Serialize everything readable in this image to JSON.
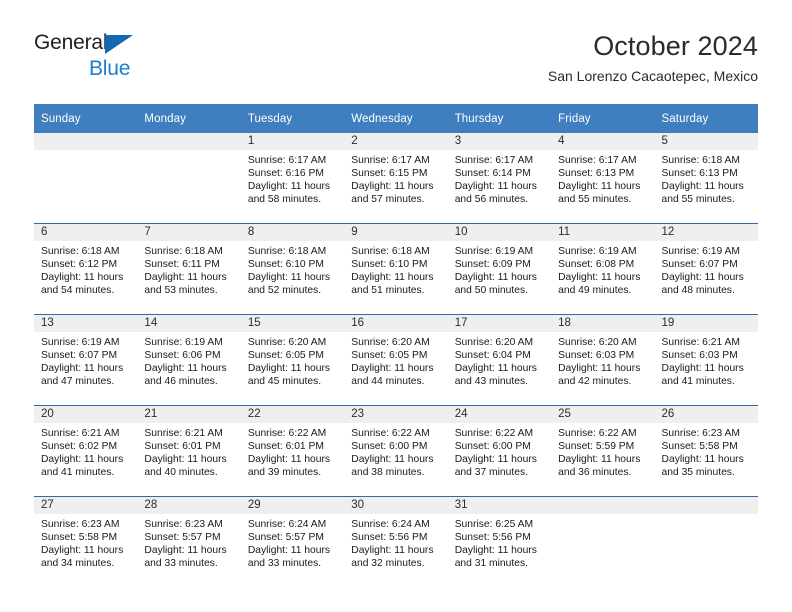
{
  "brand": {
    "name_top": "General",
    "name_bottom": "Blue"
  },
  "header": {
    "title": "October 2024",
    "subtitle": "San Lorenzo Cacaotepec, Mexico"
  },
  "calendar": {
    "weekday_headers": [
      "Sunday",
      "Monday",
      "Tuesday",
      "Wednesday",
      "Thursday",
      "Friday",
      "Saturday"
    ],
    "colors": {
      "header_background": "#3f7fbf",
      "header_text": "#ffffff",
      "daynum_band": "#efefef",
      "week_separator": "#2f6ca8",
      "brand_blue": "#1b7ed1",
      "cell_background": "#ffffff"
    },
    "weeks": [
      [
        {
          "day": "",
          "sunrise": "",
          "sunset": "",
          "daylight": ""
        },
        {
          "day": "",
          "sunrise": "",
          "sunset": "",
          "daylight": ""
        },
        {
          "day": "1",
          "sunrise": "Sunrise: 6:17 AM",
          "sunset": "Sunset: 6:16 PM",
          "daylight": "Daylight: 11 hours and 58 minutes."
        },
        {
          "day": "2",
          "sunrise": "Sunrise: 6:17 AM",
          "sunset": "Sunset: 6:15 PM",
          "daylight": "Daylight: 11 hours and 57 minutes."
        },
        {
          "day": "3",
          "sunrise": "Sunrise: 6:17 AM",
          "sunset": "Sunset: 6:14 PM",
          "daylight": "Daylight: 11 hours and 56 minutes."
        },
        {
          "day": "4",
          "sunrise": "Sunrise: 6:17 AM",
          "sunset": "Sunset: 6:13 PM",
          "daylight": "Daylight: 11 hours and 55 minutes."
        },
        {
          "day": "5",
          "sunrise": "Sunrise: 6:18 AM",
          "sunset": "Sunset: 6:13 PM",
          "daylight": "Daylight: 11 hours and 55 minutes."
        }
      ],
      [
        {
          "day": "6",
          "sunrise": "Sunrise: 6:18 AM",
          "sunset": "Sunset: 6:12 PM",
          "daylight": "Daylight: 11 hours and 54 minutes."
        },
        {
          "day": "7",
          "sunrise": "Sunrise: 6:18 AM",
          "sunset": "Sunset: 6:11 PM",
          "daylight": "Daylight: 11 hours and 53 minutes."
        },
        {
          "day": "8",
          "sunrise": "Sunrise: 6:18 AM",
          "sunset": "Sunset: 6:10 PM",
          "daylight": "Daylight: 11 hours and 52 minutes."
        },
        {
          "day": "9",
          "sunrise": "Sunrise: 6:18 AM",
          "sunset": "Sunset: 6:10 PM",
          "daylight": "Daylight: 11 hours and 51 minutes."
        },
        {
          "day": "10",
          "sunrise": "Sunrise: 6:19 AM",
          "sunset": "Sunset: 6:09 PM",
          "daylight": "Daylight: 11 hours and 50 minutes."
        },
        {
          "day": "11",
          "sunrise": "Sunrise: 6:19 AM",
          "sunset": "Sunset: 6:08 PM",
          "daylight": "Daylight: 11 hours and 49 minutes."
        },
        {
          "day": "12",
          "sunrise": "Sunrise: 6:19 AM",
          "sunset": "Sunset: 6:07 PM",
          "daylight": "Daylight: 11 hours and 48 minutes."
        }
      ],
      [
        {
          "day": "13",
          "sunrise": "Sunrise: 6:19 AM",
          "sunset": "Sunset: 6:07 PM",
          "daylight": "Daylight: 11 hours and 47 minutes."
        },
        {
          "day": "14",
          "sunrise": "Sunrise: 6:19 AM",
          "sunset": "Sunset: 6:06 PM",
          "daylight": "Daylight: 11 hours and 46 minutes."
        },
        {
          "day": "15",
          "sunrise": "Sunrise: 6:20 AM",
          "sunset": "Sunset: 6:05 PM",
          "daylight": "Daylight: 11 hours and 45 minutes."
        },
        {
          "day": "16",
          "sunrise": "Sunrise: 6:20 AM",
          "sunset": "Sunset: 6:05 PM",
          "daylight": "Daylight: 11 hours and 44 minutes."
        },
        {
          "day": "17",
          "sunrise": "Sunrise: 6:20 AM",
          "sunset": "Sunset: 6:04 PM",
          "daylight": "Daylight: 11 hours and 43 minutes."
        },
        {
          "day": "18",
          "sunrise": "Sunrise: 6:20 AM",
          "sunset": "Sunset: 6:03 PM",
          "daylight": "Daylight: 11 hours and 42 minutes."
        },
        {
          "day": "19",
          "sunrise": "Sunrise: 6:21 AM",
          "sunset": "Sunset: 6:03 PM",
          "daylight": "Daylight: 11 hours and 41 minutes."
        }
      ],
      [
        {
          "day": "20",
          "sunrise": "Sunrise: 6:21 AM",
          "sunset": "Sunset: 6:02 PM",
          "daylight": "Daylight: 11 hours and 41 minutes."
        },
        {
          "day": "21",
          "sunrise": "Sunrise: 6:21 AM",
          "sunset": "Sunset: 6:01 PM",
          "daylight": "Daylight: 11 hours and 40 minutes."
        },
        {
          "day": "22",
          "sunrise": "Sunrise: 6:22 AM",
          "sunset": "Sunset: 6:01 PM",
          "daylight": "Daylight: 11 hours and 39 minutes."
        },
        {
          "day": "23",
          "sunrise": "Sunrise: 6:22 AM",
          "sunset": "Sunset: 6:00 PM",
          "daylight": "Daylight: 11 hours and 38 minutes."
        },
        {
          "day": "24",
          "sunrise": "Sunrise: 6:22 AM",
          "sunset": "Sunset: 6:00 PM",
          "daylight": "Daylight: 11 hours and 37 minutes."
        },
        {
          "day": "25",
          "sunrise": "Sunrise: 6:22 AM",
          "sunset": "Sunset: 5:59 PM",
          "daylight": "Daylight: 11 hours and 36 minutes."
        },
        {
          "day": "26",
          "sunrise": "Sunrise: 6:23 AM",
          "sunset": "Sunset: 5:58 PM",
          "daylight": "Daylight: 11 hours and 35 minutes."
        }
      ],
      [
        {
          "day": "27",
          "sunrise": "Sunrise: 6:23 AM",
          "sunset": "Sunset: 5:58 PM",
          "daylight": "Daylight: 11 hours and 34 minutes."
        },
        {
          "day": "28",
          "sunrise": "Sunrise: 6:23 AM",
          "sunset": "Sunset: 5:57 PM",
          "daylight": "Daylight: 11 hours and 33 minutes."
        },
        {
          "day": "29",
          "sunrise": "Sunrise: 6:24 AM",
          "sunset": "Sunset: 5:57 PM",
          "daylight": "Daylight: 11 hours and 33 minutes."
        },
        {
          "day": "30",
          "sunrise": "Sunrise: 6:24 AM",
          "sunset": "Sunset: 5:56 PM",
          "daylight": "Daylight: 11 hours and 32 minutes."
        },
        {
          "day": "31",
          "sunrise": "Sunrise: 6:25 AM",
          "sunset": "Sunset: 5:56 PM",
          "daylight": "Daylight: 11 hours and 31 minutes."
        },
        {
          "day": "",
          "sunrise": "",
          "sunset": "",
          "daylight": ""
        },
        {
          "day": "",
          "sunrise": "",
          "sunset": "",
          "daylight": ""
        }
      ]
    ]
  }
}
